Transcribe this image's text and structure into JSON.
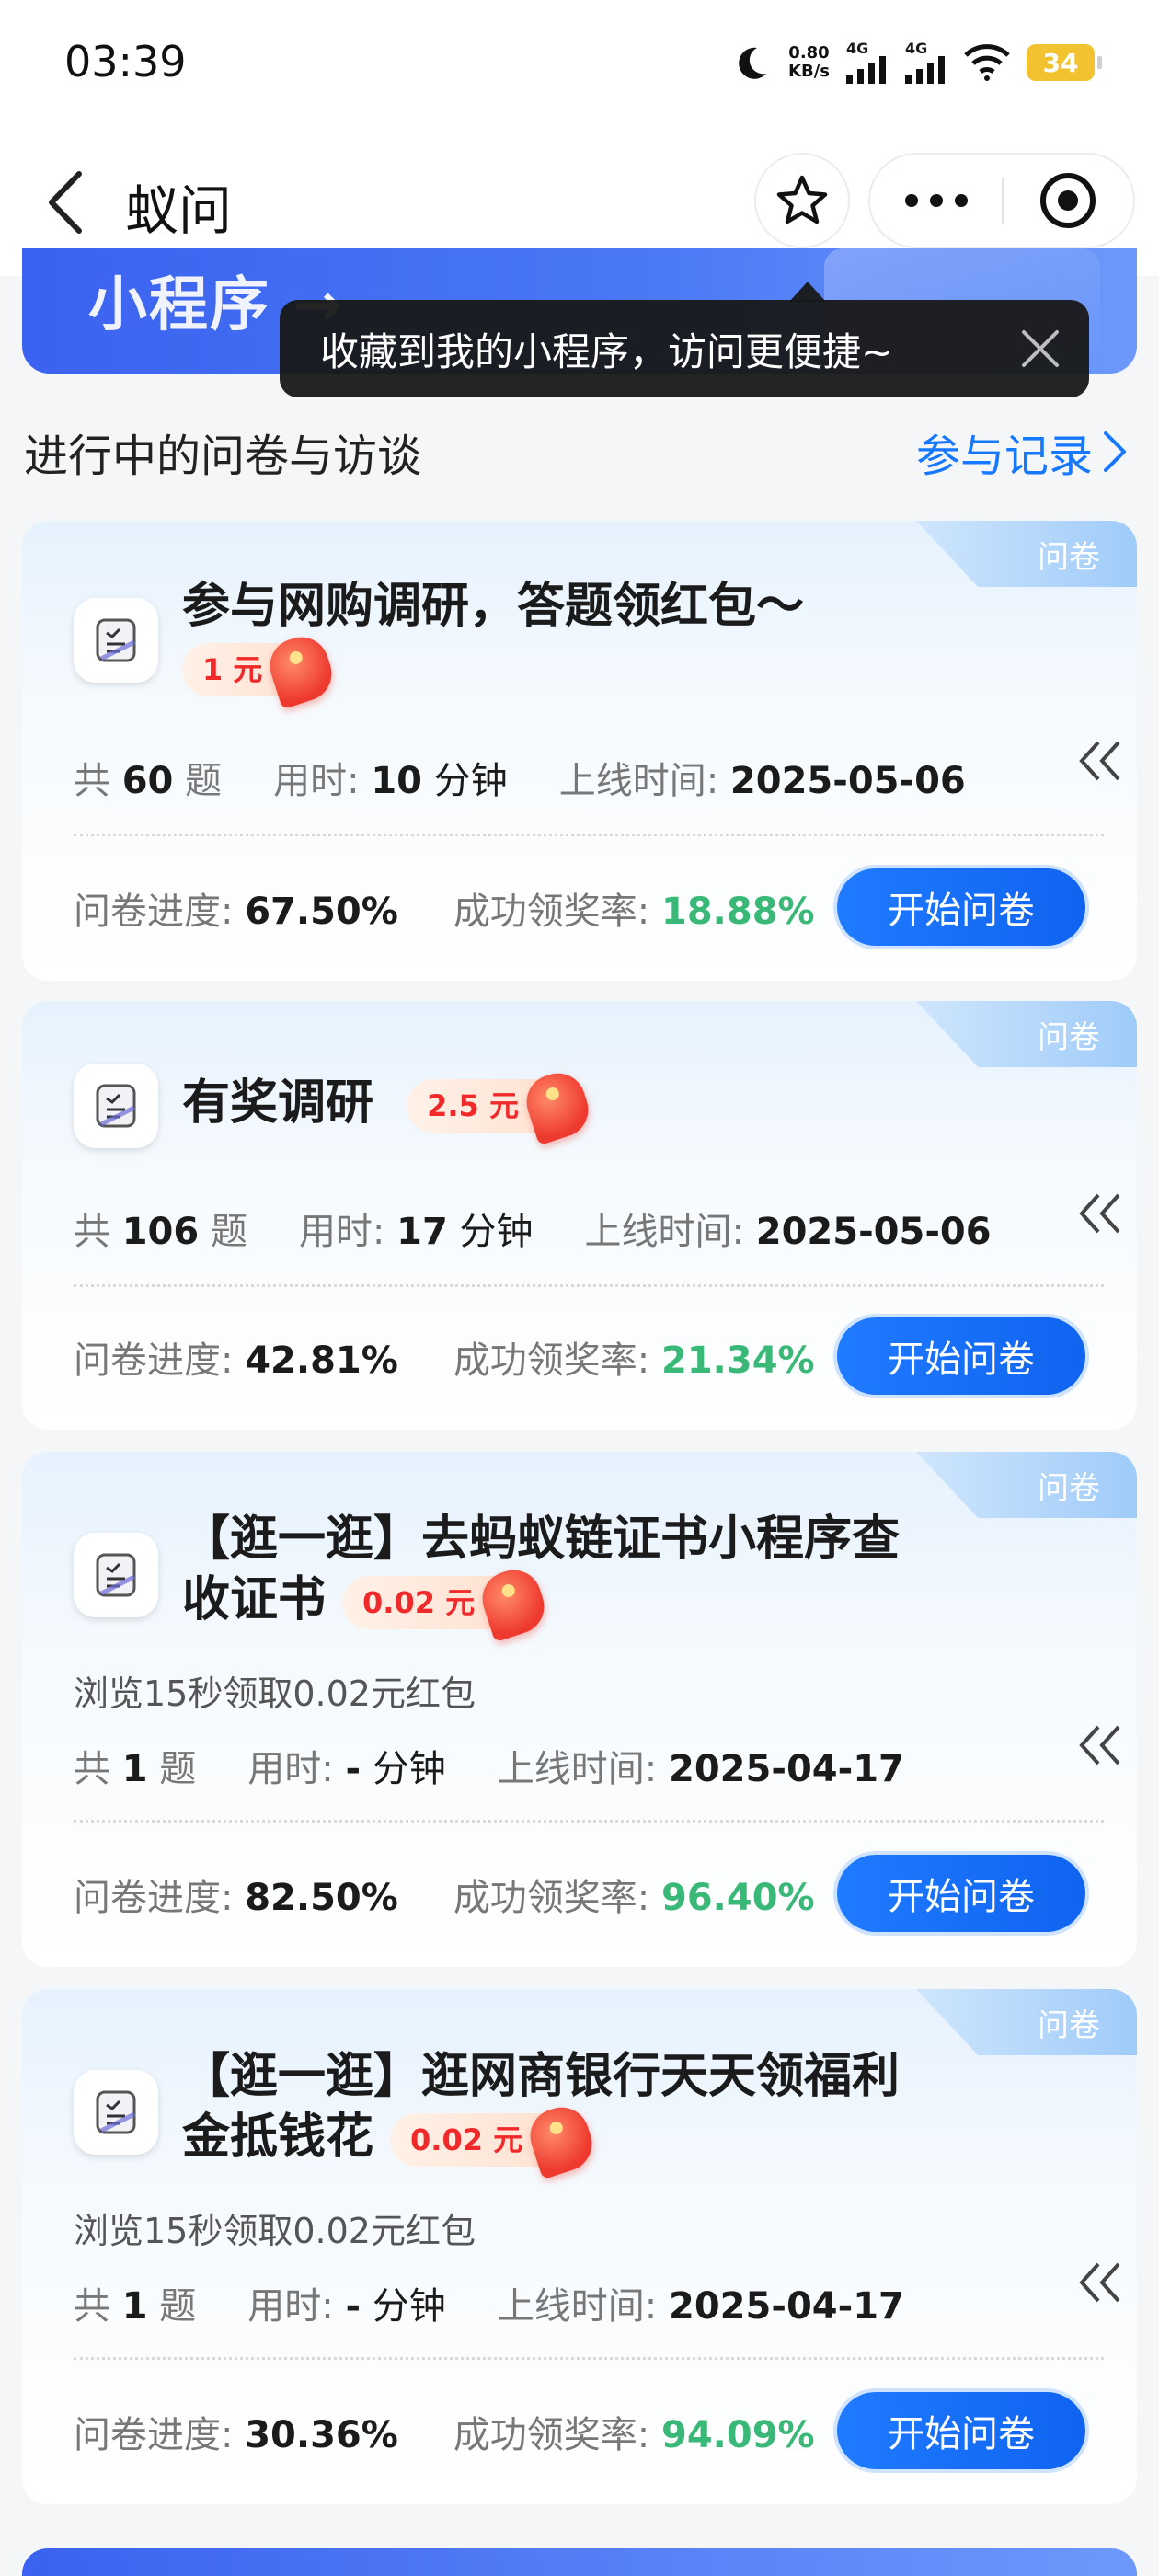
{
  "status_bar": {
    "time": "03:39",
    "net_speed_value": "0.80",
    "net_speed_unit": "KB/s",
    "signal1": "4G",
    "signal2": "4G",
    "battery": "34"
  },
  "nav": {
    "title": "蚁问"
  },
  "banner": {
    "text": "小程序 →"
  },
  "tooltip": {
    "text": "收藏到我的小程序，访问更便捷~"
  },
  "section": {
    "title": "进行中的问卷与访谈",
    "link": "参与记录"
  },
  "labels": {
    "tag": "问卷",
    "count_prefix": "共",
    "count_suffix": "题",
    "duration_label": "用时:",
    "duration_unit": "分钟",
    "online_label": "上线时间:",
    "progress_label": "问卷进度:",
    "success_label": "成功领奖率:",
    "start_button": "开始问卷"
  },
  "cards": [
    {
      "title": "参与网购调研，答题领红包～",
      "title_line2": "",
      "reward": "1 元",
      "description": "",
      "count": "60",
      "duration": "10",
      "online": "2025-05-06",
      "progress": "67.50%",
      "success_rate": "18.88%"
    },
    {
      "title": "有奖调研",
      "title_line2": "",
      "reward": "2.5 元",
      "description": "",
      "count": "106",
      "duration": "17",
      "online": "2025-05-06",
      "progress": "42.81%",
      "success_rate": "21.34%"
    },
    {
      "title": "【逛一逛】去蚂蚁链证书小程序查",
      "title_line2": "收证书",
      "reward": "0.02 元",
      "description": "浏览15秒领取0.02元红包",
      "count": "1",
      "duration": "-",
      "online": "2025-04-17",
      "progress": "82.50%",
      "success_rate": "96.40%"
    },
    {
      "title": "【逛一逛】逛网商银行天天领福利",
      "title_line2": "金抵钱花",
      "reward": "0.02 元",
      "description": "浏览15秒领取0.02元红包",
      "count": "1",
      "duration": "-",
      "online": "2025-04-17",
      "progress": "30.36%",
      "success_rate": "94.09%"
    }
  ],
  "colors": {
    "primary": "#1677ff",
    "success": "#3ab877",
    "reward": "#f02a2a"
  }
}
